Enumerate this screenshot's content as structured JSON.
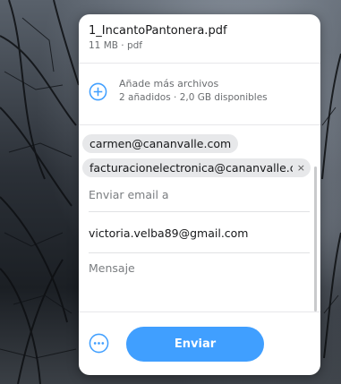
{
  "file": {
    "name": "1_IncantoPantonera.pdf",
    "meta": "11 MB · pdf"
  },
  "add_files": {
    "title": "Añade más archivos",
    "subtitle": "2 añadidos · 2,0 GB disponibles",
    "icon": "plus-circle-icon"
  },
  "recipients": [
    {
      "email": "carmen@cananvalle.com"
    },
    {
      "email": "facturacionelectronica@cananvalle.c",
      "remove_icon": "×"
    }
  ],
  "email_input": {
    "placeholder": "Enviar email a",
    "value": ""
  },
  "from_email": "victoria.velba89@gmail.com",
  "message": {
    "placeholder": "Mensaje",
    "value": ""
  },
  "footer": {
    "more_icon": "more-options-icon",
    "send_label": "Enviar"
  },
  "colors": {
    "accent": "#409fff",
    "chip_bg": "#e7e8ea"
  }
}
